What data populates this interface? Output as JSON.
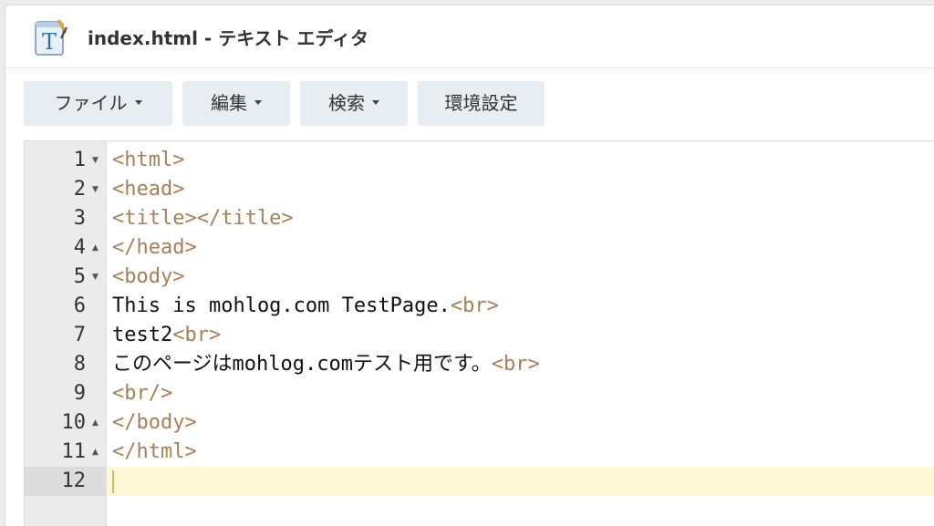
{
  "window": {
    "title": "index.html - テキスト エディタ",
    "app_icon": "text-editor-icon"
  },
  "toolbar": {
    "file": "ファイル",
    "edit": "編集",
    "search": "検索",
    "settings": "環境設定"
  },
  "editor": {
    "active_line": 12,
    "lines": [
      {
        "num": "1",
        "fold": "expanded",
        "parts": [
          {
            "t": "tag",
            "s": "<html>"
          }
        ]
      },
      {
        "num": "2",
        "fold": "expanded",
        "parts": [
          {
            "t": "tag",
            "s": "<head>"
          }
        ]
      },
      {
        "num": "3",
        "fold": "",
        "parts": [
          {
            "t": "tag",
            "s": "<title></title>"
          }
        ]
      },
      {
        "num": "4",
        "fold": "end",
        "parts": [
          {
            "t": "tag",
            "s": "</head>"
          }
        ]
      },
      {
        "num": "5",
        "fold": "expanded",
        "parts": [
          {
            "t": "tag",
            "s": "<body>"
          }
        ]
      },
      {
        "num": "6",
        "fold": "",
        "parts": [
          {
            "t": "txt",
            "s": "This is mohlog.com TestPage."
          },
          {
            "t": "tag",
            "s": "<br>"
          }
        ]
      },
      {
        "num": "7",
        "fold": "",
        "parts": [
          {
            "t": "txt",
            "s": "test2"
          },
          {
            "t": "tag",
            "s": "<br>"
          }
        ]
      },
      {
        "num": "8",
        "fold": "",
        "parts": [
          {
            "t": "txt",
            "s": "このページはmohlog.comテスト用です。"
          },
          {
            "t": "tag",
            "s": "<br>"
          }
        ]
      },
      {
        "num": "9",
        "fold": "",
        "parts": [
          {
            "t": "tag",
            "s": "<br/>"
          }
        ]
      },
      {
        "num": "10",
        "fold": "end",
        "parts": [
          {
            "t": "tag",
            "s": "</body>"
          }
        ]
      },
      {
        "num": "11",
        "fold": "end",
        "parts": [
          {
            "t": "tag",
            "s": "</html>"
          }
        ]
      },
      {
        "num": "12",
        "fold": "",
        "parts": []
      }
    ]
  },
  "colors": {
    "tag": "#a67f59",
    "text": "#111111",
    "active_line": "#fdf8d8",
    "button_bg": "#e8edf2"
  }
}
